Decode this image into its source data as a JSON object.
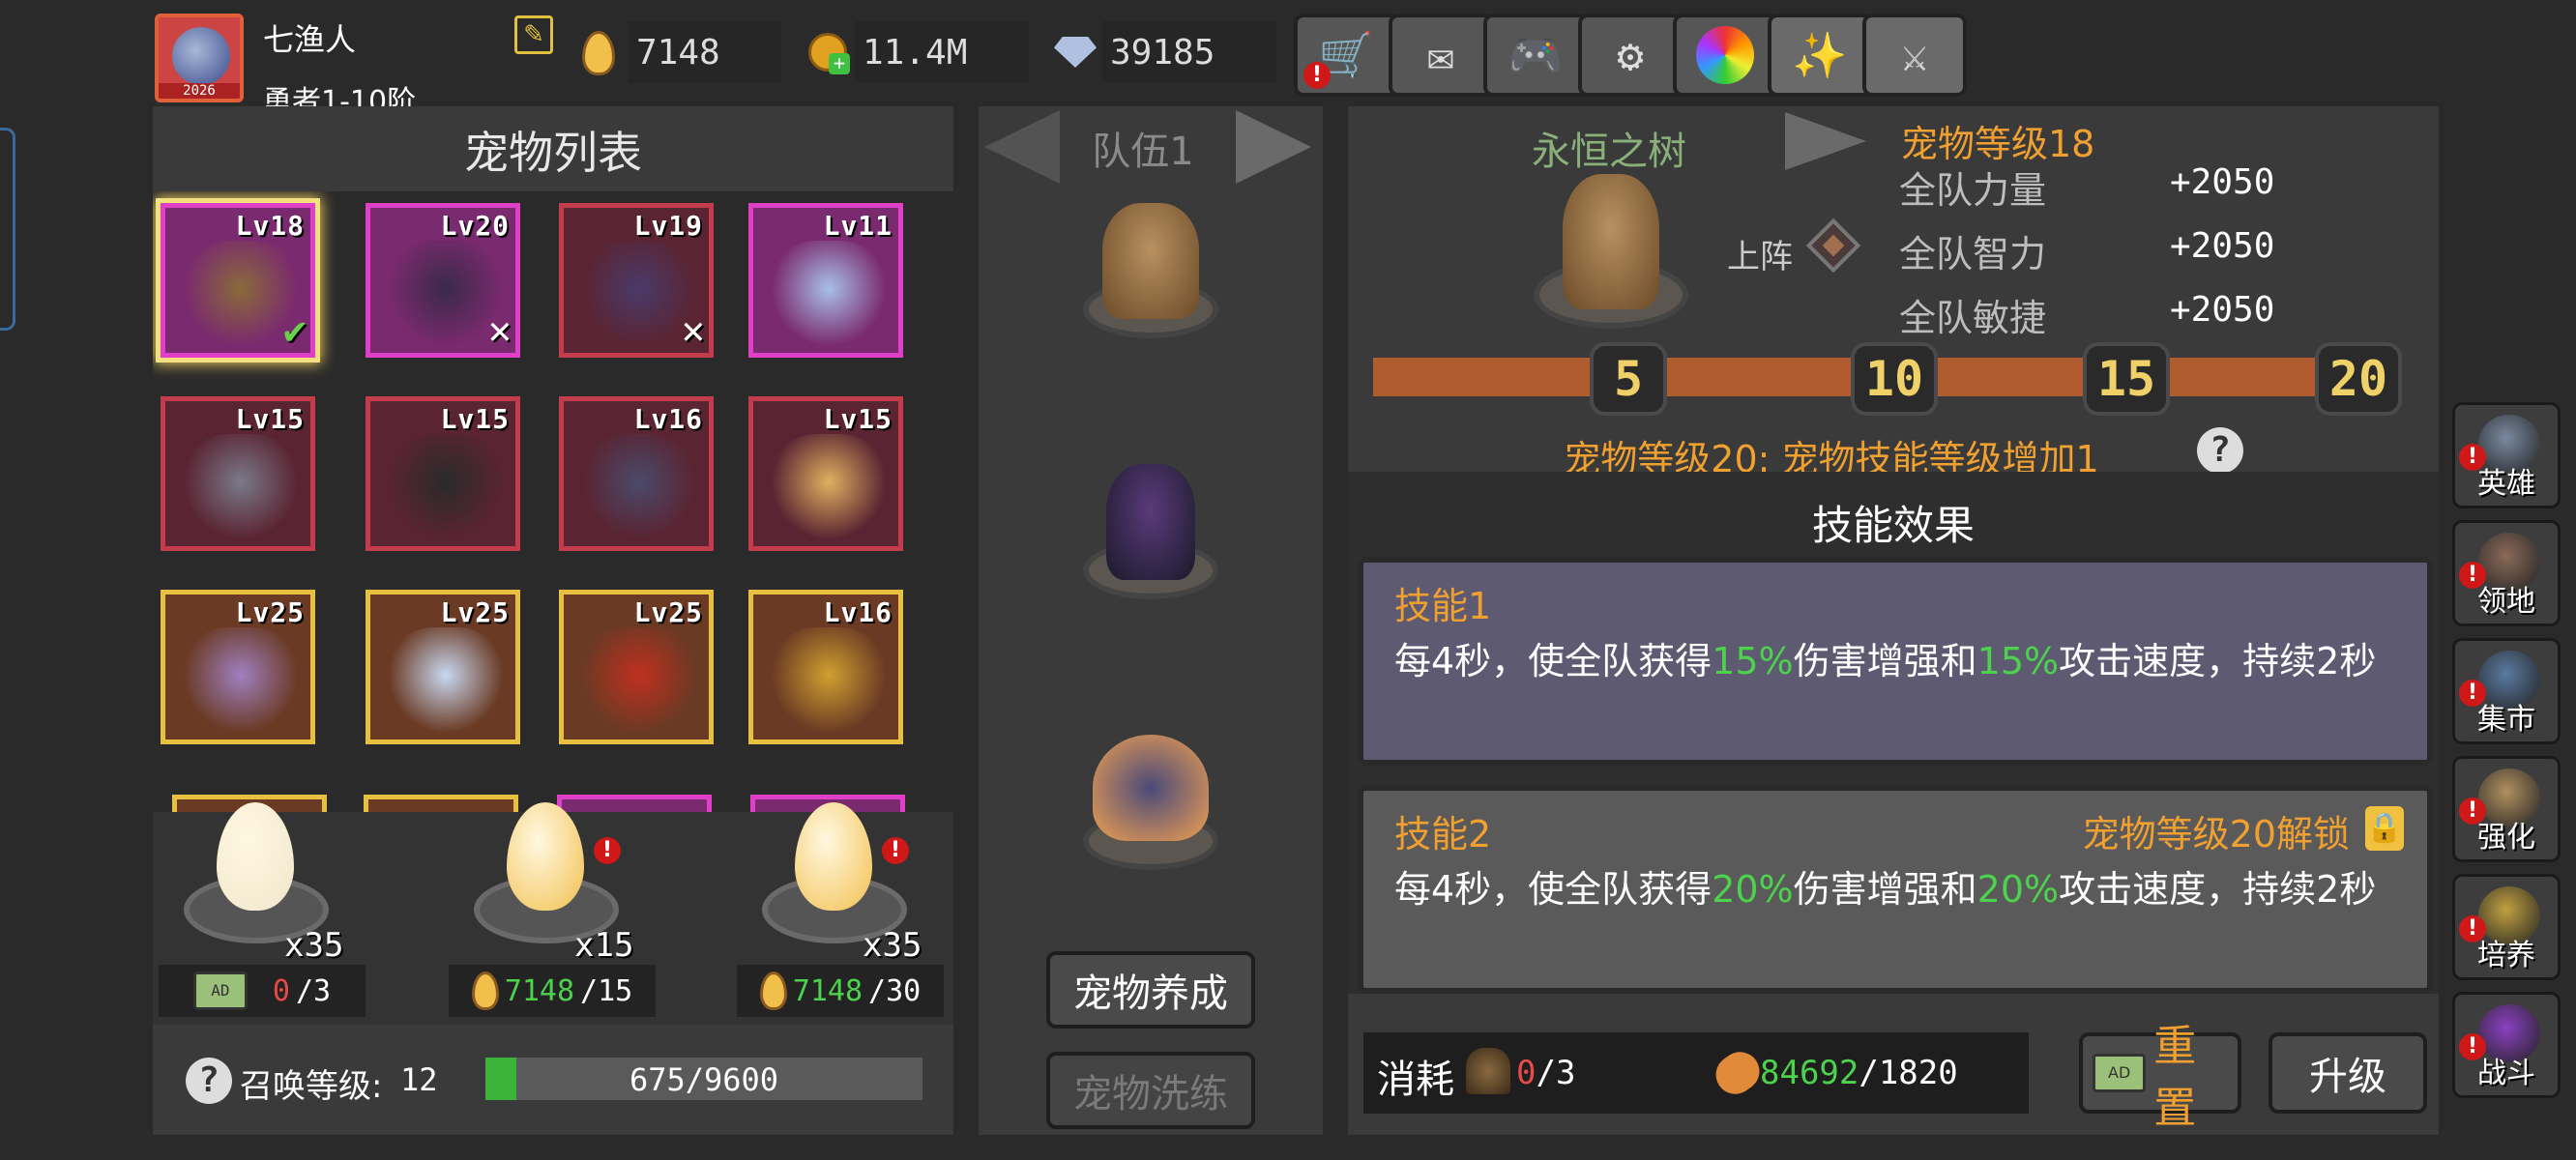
{
  "player": {
    "name": "七渔人",
    "rank": "勇者1-10阶",
    "avatar_year": "2026"
  },
  "resources": [
    {
      "icon": "egg-icon",
      "value": "7148"
    },
    {
      "icon": "gold-plus-icon",
      "value": "11.4M"
    },
    {
      "icon": "diamond-plus-icon",
      "value": "39185"
    }
  ],
  "toolbar": [
    "shop-cart-icon",
    "mail-icon",
    "gamepad-icon",
    "gear-icon",
    "color-wheel-icon",
    "fireworks-icon",
    "swords-disabled-icon"
  ],
  "pet_list": {
    "title": "宠物列表",
    "cards": [
      {
        "level": "Lv18",
        "mark": "✔",
        "rarity": "pink",
        "selected": true,
        "pet": "treant"
      },
      {
        "level": "Lv20",
        "mark": "✕",
        "rarity": "pink",
        "pet": "witch"
      },
      {
        "level": "Lv19",
        "mark": "✕",
        "rarity": "red",
        "pet": "bat"
      },
      {
        "level": "Lv11",
        "mark": "",
        "rarity": "pink",
        "pet": "ghost"
      },
      {
        "level": "Lv15",
        "mark": "",
        "rarity": "red",
        "pet": "gargoyle"
      },
      {
        "level": "Lv15",
        "mark": "",
        "rarity": "red",
        "pet": "reaper"
      },
      {
        "level": "Lv16",
        "mark": "",
        "rarity": "red",
        "pet": "unicorn"
      },
      {
        "level": "Lv15",
        "mark": "",
        "rarity": "red",
        "pet": "skull-mage"
      },
      {
        "level": "Lv25",
        "mark": "",
        "rarity": "yellow",
        "pet": "scorpion"
      },
      {
        "level": "Lv25",
        "mark": "",
        "rarity": "yellow",
        "pet": "ice-wolf"
      },
      {
        "level": "Lv25",
        "mark": "",
        "rarity": "yellow",
        "pet": "fire-beast"
      },
      {
        "level": "Lv16",
        "mark": "",
        "rarity": "yellow",
        "pet": "gem-turtle"
      }
    ]
  },
  "eggs": [
    {
      "count": "x35",
      "cost_have": "0",
      "cost_need": "/3",
      "cost_icon": "ad-video-icon",
      "badge": false
    },
    {
      "count": "x15",
      "cost_have": "7148",
      "cost_need": "/15",
      "cost_icon": "egg-icon",
      "badge": true
    },
    {
      "count": "x35",
      "cost_have": "7148",
      "cost_need": "/30",
      "cost_icon": "egg-icon",
      "badge": true
    }
  ],
  "summon": {
    "label": "召唤等级:",
    "level": "12",
    "progress_text": "675/9600",
    "progress": 0.0703
  },
  "team": {
    "title": "队伍1",
    "buttons": {
      "train": "宠物养成",
      "refine": "宠物洗练"
    }
  },
  "detail": {
    "pet_name": "永恒之树",
    "deploy_label": "上阵",
    "pet_level": "宠物等级18",
    "stats": [
      {
        "label": "全队力量",
        "value": "+2050"
      },
      {
        "label": "全队智力",
        "value": "+2050"
      },
      {
        "label": "全队敏捷",
        "value": "+2050"
      }
    ],
    "milestones": [
      "5",
      "10",
      "15",
      "20"
    ],
    "level_progress": 0.9,
    "milestone_note": "宠物等级20: 宠物技能等级增加1"
  },
  "skills": {
    "title": "技能效果",
    "items": [
      {
        "name": "技能1",
        "pre": "每4秒，使全队获得",
        "v1": "15%",
        "mid": "伤害增强和",
        "v2": "15%",
        "post": "攻击速度，持续2秒",
        "lock": ""
      },
      {
        "name": "技能2",
        "pre": "每4秒，使全队获得",
        "v1": "20%",
        "mid": "伤害增强和",
        "v2": "20%",
        "post": "攻击速度，持续2秒",
        "lock": "宠物等级20解锁"
      }
    ]
  },
  "cost": {
    "label": "消耗",
    "have1": "0",
    "need1": "/3",
    "have2": "84692",
    "need2": "/1820"
  },
  "actions": {
    "reset": "重置",
    "upgrade": "升级"
  },
  "side_menu": [
    {
      "label": "英雄",
      "icon": "helmet-icon"
    },
    {
      "label": "领地",
      "icon": "castle-icon"
    },
    {
      "label": "集市",
      "icon": "market-icon"
    },
    {
      "label": "强化",
      "icon": "crest-icon"
    },
    {
      "label": "培养",
      "icon": "chalice-icon"
    },
    {
      "label": "战斗",
      "icon": "portal-icon"
    }
  ],
  "colors": {
    "accent": "#f0a030",
    "green": "#4cd24c",
    "red": "#e84a4a",
    "gold": "#f0d068"
  }
}
